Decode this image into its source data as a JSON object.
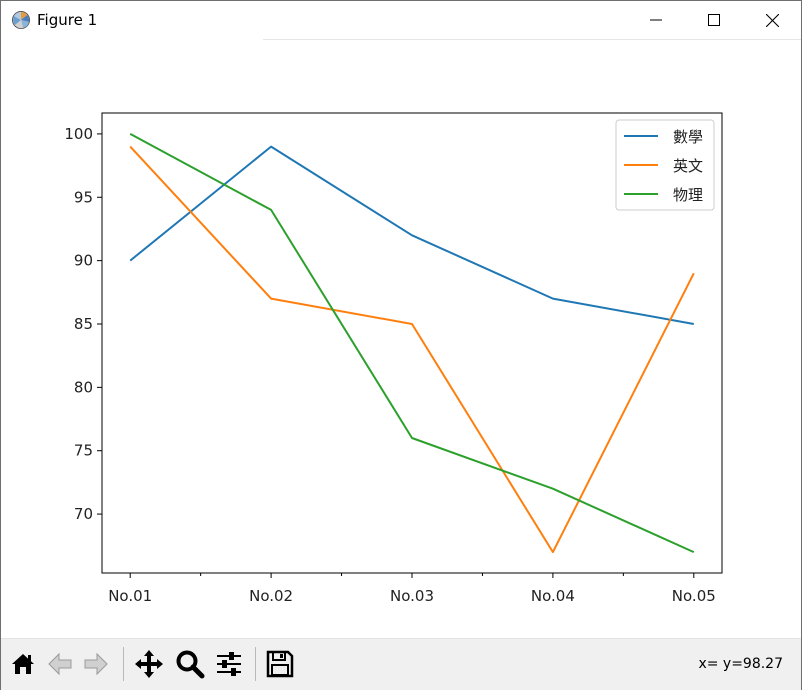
{
  "window": {
    "title": "Figure 1"
  },
  "toolbar": {
    "buttons": [
      {
        "name": "home",
        "icon": "home-icon"
      },
      {
        "name": "back",
        "icon": "arrow-left-icon"
      },
      {
        "name": "forward",
        "icon": "arrow-right-icon"
      },
      {
        "name": "pan",
        "icon": "move-icon"
      },
      {
        "name": "zoom",
        "icon": "magnifier-icon"
      },
      {
        "name": "configure",
        "icon": "sliders-icon"
      },
      {
        "name": "save",
        "icon": "floppy-icon"
      }
    ],
    "coordinate_readout": "x= y=98.27"
  },
  "chart_data": {
    "type": "line",
    "categories": [
      "No.01",
      "No.02",
      "No.03",
      "No.04",
      "No.05"
    ],
    "series": [
      {
        "name": "數學",
        "color": "#1f77b4",
        "values": [
          90,
          99,
          92,
          87,
          85
        ]
      },
      {
        "name": "英文",
        "color": "#ff7f0e",
        "values": [
          99,
          87,
          85,
          67,
          89
        ]
      },
      {
        "name": "物理",
        "color": "#2ca02c",
        "values": [
          100,
          94,
          76,
          72,
          67
        ]
      }
    ],
    "yticks": [
      70,
      75,
      80,
      85,
      90,
      95,
      100
    ],
    "ylim": [
      65.35,
      101.65
    ],
    "grid": false,
    "legend_position": "upper right"
  }
}
